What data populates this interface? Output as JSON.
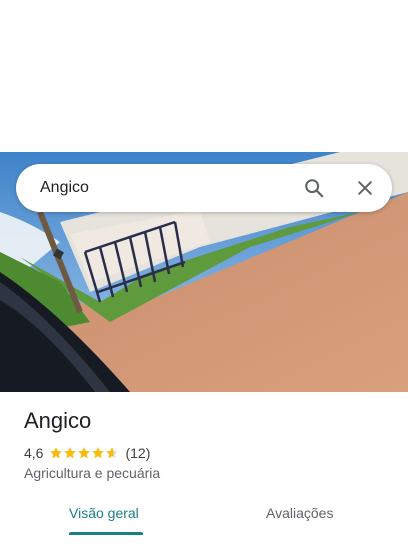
{
  "search": {
    "query": "Angico"
  },
  "place": {
    "name": "Angico",
    "rating": "4,6",
    "rating_value": 4.6,
    "review_count": "(12)",
    "category": "Agricultura e pecuária"
  },
  "tabs": [
    {
      "label": "Visão geral",
      "selected": true
    },
    {
      "label": "Avaliações",
      "selected": false
    }
  ],
  "colors": {
    "accent": "#1a7f86",
    "star": "#fbbc04"
  },
  "icons": {
    "search": "search-icon",
    "close": "close-icon",
    "star": "star-icon"
  }
}
